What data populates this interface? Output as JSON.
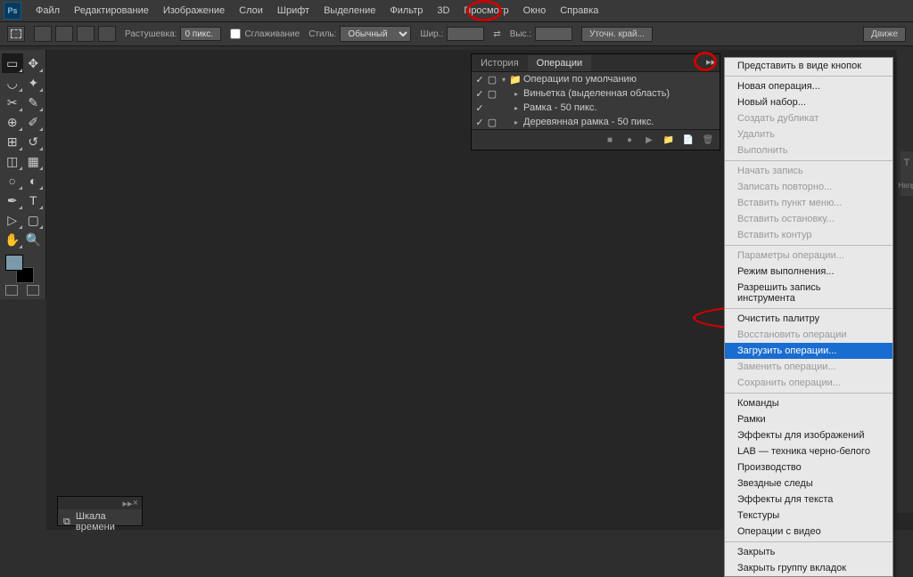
{
  "app": {
    "logo": "Ps"
  },
  "menubar": [
    "Файл",
    "Редактирование",
    "Изображение",
    "Слои",
    "Шрифт",
    "Выделение",
    "Фильтр",
    "3D",
    "Просмотр",
    "Окно",
    "Справка"
  ],
  "menubar_highlighted_index": 9,
  "optionsbar": {
    "feather_label": "Растушевка:",
    "feather_value": "0 пикс.",
    "antialias_label": "Сглаживание",
    "style_label": "Стиль:",
    "style_value": "Обычный",
    "width_label": "Шир.:",
    "height_label": "Выс.:",
    "refine_edge": "Уточн. край...",
    "motion": "Движе"
  },
  "actions_panel": {
    "tabs": [
      "История",
      "Операции"
    ],
    "active_tab_index": 1,
    "set_name": "Операции по умолчанию",
    "items": [
      "Виньетка (выделенная область)",
      "Рамка - 50 пикс.",
      "Деревянная рамка - 50 пикс."
    ]
  },
  "timeline": {
    "title": "Шкала времени"
  },
  "dropdown": {
    "groups": [
      [
        {
          "label": "Представить в виде кнопок",
          "disabled": false
        }
      ],
      [
        {
          "label": "Новая операция...",
          "disabled": false
        },
        {
          "label": "Новый набор...",
          "disabled": false
        },
        {
          "label": "Создать дубликат",
          "disabled": true
        },
        {
          "label": "Удалить",
          "disabled": true
        },
        {
          "label": "Выполнить",
          "disabled": true
        }
      ],
      [
        {
          "label": "Начать запись",
          "disabled": true
        },
        {
          "label": "Записать повторно...",
          "disabled": true
        },
        {
          "label": "Вставить пункт меню...",
          "disabled": true
        },
        {
          "label": "Вставить остановку...",
          "disabled": true
        },
        {
          "label": "Вставить контур",
          "disabled": true
        }
      ],
      [
        {
          "label": "Параметры операции...",
          "disabled": true
        },
        {
          "label": "Режим выполнения...",
          "disabled": false
        },
        {
          "label": "Разрешить запись инструмента",
          "disabled": false
        }
      ],
      [
        {
          "label": "Очистить палитру",
          "disabled": false
        },
        {
          "label": "Восстановить операции",
          "disabled": true
        },
        {
          "label": "Загрузить операции...",
          "disabled": false,
          "selected": true
        },
        {
          "label": "Заменить операции...",
          "disabled": true
        },
        {
          "label": "Сохранить операции...",
          "disabled": true
        }
      ],
      [
        {
          "label": "Команды",
          "disabled": false
        },
        {
          "label": "Рамки",
          "disabled": false
        },
        {
          "label": "Эффекты для изображений",
          "disabled": false
        },
        {
          "label": "LAB — техника черно-белого",
          "disabled": false
        },
        {
          "label": "Производство",
          "disabled": false
        },
        {
          "label": "Звездные следы",
          "disabled": false
        },
        {
          "label": "Эффекты для текста",
          "disabled": false
        },
        {
          "label": "Текстуры",
          "disabled": false
        },
        {
          "label": "Операции с видео",
          "disabled": false
        }
      ],
      [
        {
          "label": "Закрыть",
          "disabled": false
        },
        {
          "label": "Закрыть группу вкладок",
          "disabled": false
        }
      ]
    ]
  },
  "right_label": "Непр"
}
